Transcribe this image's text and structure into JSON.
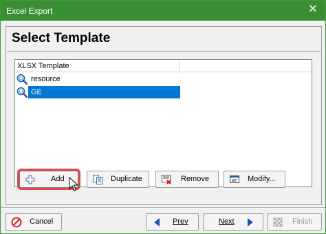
{
  "window": {
    "title": "Excel Export",
    "close_glyph": "✕"
  },
  "page": {
    "heading": "Select Template"
  },
  "template_list": {
    "columns": [
      "XLSX Template",
      ""
    ],
    "items": [
      {
        "label": "resource",
        "icon": "magnifier-icon",
        "selected": false
      },
      {
        "label": "GE",
        "icon": "magnifier-icon",
        "selected": true
      }
    ]
  },
  "list_actions": {
    "add": "Add",
    "duplicate": "Duplicate",
    "remove": "Remove",
    "modify": "Modify..."
  },
  "wizard_nav": {
    "cancel": "Cancel",
    "prev": "Prev",
    "next": "Next",
    "finish": "Finish"
  },
  "colors": {
    "titlebar": "#3a8f35",
    "selection": "#0078d7",
    "highlight": "#e0484e"
  }
}
